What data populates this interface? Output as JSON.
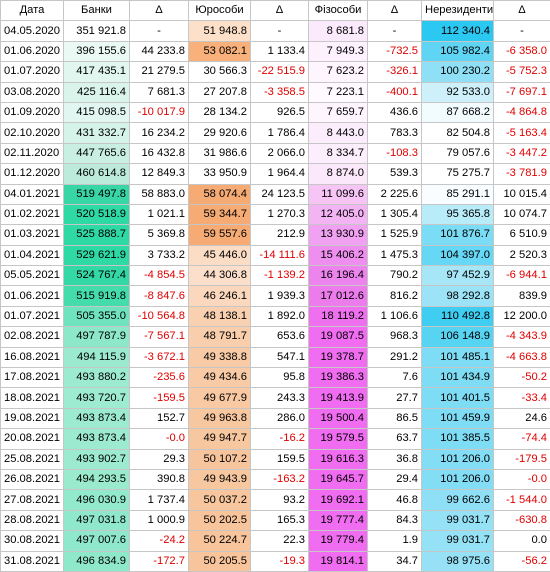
{
  "headers": [
    "Дата",
    "Банки",
    "Δ",
    "Юрособи",
    "Δ",
    "Фізособи",
    "Δ",
    "Нерезиденти",
    "Δ"
  ],
  "colors": {
    "negative": "#e00000",
    "banks_scale": [
      "#ffffff",
      "#e3f6ef",
      "#2fd9a4"
    ],
    "yur_scale": [
      "#fde8d8",
      "#f6ab75"
    ],
    "fiz_scale": [
      "#fbe7fb",
      "#f06cf0"
    ],
    "nonres_scale": [
      "#eaf7fc",
      "#12c8f1"
    ]
  },
  "rows": [
    {
      "date": "04.05.2020",
      "banks": "351 921.8",
      "d1": "-",
      "yur": "51 948.8",
      "d2": "-",
      "fiz": "8 681.8",
      "d3": "-",
      "nonres": "112 340.4",
      "d4": "-",
      "bg": [
        "#ffffff",
        "#fde0c9",
        "#fbeafb",
        "#2bc9f1"
      ]
    },
    {
      "date": "01.06.2020",
      "banks": "396 155.6",
      "d1": "44 233.8",
      "yur": "53 082.1",
      "d2": "1 133.4",
      "fiz": "7 949.3",
      "d3": "-732.5",
      "nonres": "105 982.4",
      "d4": "-6 358.0",
      "bg": [
        "#ebf9f5",
        "#f8b17b",
        "#fdf1fd",
        "#5fd4f3"
      ]
    },
    {
      "date": "01.07.2020",
      "banks": "417 435.1",
      "d1": "21 279.5",
      "yur": "30 566.3",
      "d2": "-22 515.9",
      "fiz": "7 623.2",
      "d3": "-326.1",
      "nonres": "100 230.2",
      "d4": "-5 752.3",
      "bg": [
        "#e0f6ef",
        "#ffffff",
        "#fef5fe",
        "#8fe0f6"
      ]
    },
    {
      "date": "03.08.2020",
      "banks": "425 116.4",
      "d1": "7 681.3",
      "yur": "27 207.8",
      "d2": "-3 358.5",
      "fiz": "7 223.1",
      "d3": "-400.1",
      "nonres": "92 533.0",
      "d4": "-7 697.1",
      "bg": [
        "#daf4ec",
        "#ffffff",
        "#fffaff",
        "#cdf0fa"
      ]
    },
    {
      "date": "01.09.2020",
      "banks": "415 098.5",
      "d1": "-10 017.9",
      "yur": "28 134.2",
      "d2": "926.5",
      "fiz": "7 659.7",
      "d3": "436.6",
      "nonres": "87 668.2",
      "d4": "-4 864.8",
      "bg": [
        "#e1f6f0",
        "#ffffff",
        "#fef5fe",
        "#f2fbfe"
      ]
    },
    {
      "date": "02.10.2020",
      "banks": "431 332.7",
      "d1": "16 234.2",
      "yur": "29 920.6",
      "d2": "1 786.4",
      "fiz": "8 443.0",
      "d3": "783.3",
      "nonres": "82 504.8",
      "d4": "-5 163.4",
      "bg": [
        "#d6f3ea",
        "#ffffff",
        "#fcedfc",
        "#ffffff"
      ]
    },
    {
      "date": "02.11.2020",
      "banks": "447 765.6",
      "d1": "16 432.8",
      "yur": "31 986.6",
      "d2": "2 066.0",
      "fiz": "8 334.7",
      "d3": "-108.3",
      "nonres": "79 057.6",
      "d4": "-3 447.2",
      "bg": [
        "#c9efe3",
        "#ffffff",
        "#fceefc",
        "#ffffff"
      ]
    },
    {
      "date": "01.12.2020",
      "banks": "460 614.8",
      "d1": "12 849.3",
      "yur": "33 950.9",
      "d2": "1 964.4",
      "fiz": "8 874.0",
      "d3": "539.3",
      "nonres": "75 275.7",
      "d4": "-3 781.9",
      "bg": [
        "#bcebdc",
        "#ffffff",
        "#fbe8fb",
        "#ffffff"
      ]
    },
    {
      "date": "04.01.2021",
      "banks": "519 497.8",
      "d1": "58 883.0",
      "yur": "58 074.4",
      "d2": "24 123.5",
      "fiz": "11 099.6",
      "d3": "2 225.6",
      "nonres": "85 291.1",
      "d4": "10 015.4",
      "bg": [
        "#38d6a5",
        "#f6ab75",
        "#f6c5f6",
        "#fafdff"
      ]
    },
    {
      "date": "01.02.2021",
      "banks": "520 518.9",
      "d1": "1 021.1",
      "yur": "59 344.7",
      "d2": "1 270.3",
      "fiz": "12 405.0",
      "d3": "1 305.4",
      "nonres": "95 365.8",
      "d4": "10 074.7",
      "bg": [
        "#2fd9a4",
        "#f6ab75",
        "#f3b4f3",
        "#b8ecf9"
      ]
    },
    {
      "date": "01.03.2021",
      "banks": "525 888.7",
      "d1": "5 369.8",
      "yur": "59 557.6",
      "d2": "212.9",
      "fiz": "13 930.9",
      "d3": "1 525.9",
      "nonres": "101 876.7",
      "d4": "6 510.9",
      "bg": [
        "#2fd9a4",
        "#f6ab75",
        "#f1a1f1",
        "#7bdcf5"
      ]
    },
    {
      "date": "01.04.2021",
      "banks": "529 621.9",
      "d1": "3 733.2",
      "yur": "45 446.0",
      "d2": "-14 111.6",
      "fiz": "15 406.2",
      "d3": "1 475.3",
      "nonres": "104 397.0",
      "d4": "2 520.3",
      "bg": [
        "#2fd9a4",
        "#fbdcc4",
        "#ee8eee",
        "#66d7f4"
      ]
    },
    {
      "date": "05.05.2021",
      "banks": "524 767.4",
      "d1": "-4 854.5",
      "yur": "44 306.8",
      "d2": "-1 139.2",
      "fiz": "16 196.4",
      "d3": "790.2",
      "nonres": "97 452.9",
      "d4": "-6 944.1",
      "bg": [
        "#33d8a5",
        "#fcdfca",
        "#ed84ed",
        "#a6e6f7"
      ]
    },
    {
      "date": "01.06.2021",
      "banks": "515 919.8",
      "d1": "-8 847.6",
      "yur": "46 246.1",
      "d2": "1 939.3",
      "fiz": "17 012.6",
      "d3": "816.2",
      "nonres": "98 292.8",
      "d4": "839.9",
      "bg": [
        "#45dcac",
        "#fbd8bd",
        "#ec7cec",
        "#9de3f7"
      ]
    },
    {
      "date": "01.07.2021",
      "banks": "505 355.0",
      "d1": "-10 564.8",
      "yur": "48 138.1",
      "d2": "1 892.0",
      "fiz": "18 119.2",
      "d3": "1 106.6",
      "nonres": "110 492.8",
      "d4": "12 200.0",
      "bg": [
        "#6fe3bd",
        "#f9d1b1",
        "#ef70ef",
        "#3fcef2"
      ]
    },
    {
      "date": "02.08.2021",
      "banks": "497 787.9",
      "d1": "-7 567.1",
      "yur": "48 791.7",
      "d2": "653.6",
      "fiz": "19 087.5",
      "d3": "968.3",
      "nonres": "106 148.9",
      "d4": "-4 343.9",
      "bg": [
        "#8de8ca",
        "#f9ceac",
        "#f06cf0",
        "#58d4f3"
      ]
    },
    {
      "date": "16.08.2021",
      "banks": "494 115.9",
      "d1": "-3 672.1",
      "yur": "49 338.8",
      "d2": "547.1",
      "fiz": "19 378.7",
      "d3": "291.2",
      "nonres": "101 485.1",
      "d4": "-4 663.8",
      "bg": [
        "#9beacf",
        "#f8cba6",
        "#f06cf0",
        "#7edcf5"
      ]
    },
    {
      "date": "17.08.2021",
      "banks": "493 880.2",
      "d1": "-235.6",
      "yur": "49 434.6",
      "d2": "95.8",
      "fiz": "19 386.3",
      "d3": "7.6",
      "nonres": "101 434.9",
      "d4": "-50.2",
      "bg": [
        "#9ceacf",
        "#f8caa5",
        "#f06cf0",
        "#7fdcf5"
      ]
    },
    {
      "date": "18.08.2021",
      "banks": "493 720.7",
      "d1": "-159.5",
      "yur": "49 677.9",
      "d2": "243.3",
      "fiz": "19 413.9",
      "d3": "27.7",
      "nonres": "101 401.5",
      "d4": "-33.4",
      "bg": [
        "#9debd0",
        "#f8c9a3",
        "#f06cf0",
        "#7fdcf5"
      ]
    },
    {
      "date": "19.08.2021",
      "banks": "493 873.4",
      "d1": "152.7",
      "yur": "49 963.8",
      "d2": "286.0",
      "fiz": "19 500.4",
      "d3": "86.5",
      "nonres": "101 459.9",
      "d4": "24.6",
      "bg": [
        "#9ceacf",
        "#f7c7a0",
        "#f06cf0",
        "#7fdcf5"
      ]
    },
    {
      "date": "20.08.2021",
      "banks": "493 873.4",
      "d1": "-0.0",
      "yur": "49 947.7",
      "d2": "-16.2",
      "fiz": "19 579.5",
      "d3": "63.7",
      "nonres": "101 385.5",
      "d4": "-74.4",
      "bg": [
        "#9ceacf",
        "#f7c7a0",
        "#f06cf0",
        "#7fdcf5"
      ]
    },
    {
      "date": "25.08.2021",
      "banks": "493 902.7",
      "d1": "29.3",
      "yur": "50 107.2",
      "d2": "159.5",
      "fiz": "19 616.3",
      "d3": "36.8",
      "nonres": "101 206.0",
      "d4": "-179.5",
      "bg": [
        "#9ceacf",
        "#f7c59d",
        "#f06cf0",
        "#82ddf5"
      ]
    },
    {
      "date": "26.08.2021",
      "banks": "494 293.5",
      "d1": "390.8",
      "yur": "49 943.9",
      "d2": "-163.2",
      "fiz": "19 645.7",
      "d3": "29.4",
      "nonres": "101 206.0",
      "d4": "-0.0",
      "bg": [
        "#9aeace",
        "#f7c7a0",
        "#f06cf0",
        "#82ddf5"
      ]
    },
    {
      "date": "27.08.2021",
      "banks": "496 030.9",
      "d1": "1 737.4",
      "yur": "50 037.2",
      "d2": "93.2",
      "fiz": "19 692.1",
      "d3": "46.8",
      "nonres": "99 662.6",
      "d4": "-1 544.0",
      "bg": [
        "#93e9cc",
        "#f7c69e",
        "#f06cf0",
        "#8fe0f6"
      ]
    },
    {
      "date": "28.08.2021",
      "banks": "497 031.8",
      "d1": "1 000.9",
      "yur": "50 202.5",
      "d2": "165.3",
      "fiz": "19 777.4",
      "d3": "84.3",
      "nonres": "99 031.7",
      "d4": "-630.8",
      "bg": [
        "#8fe8cb",
        "#f7c49b",
        "#f06cf0",
        "#95e1f6"
      ]
    },
    {
      "date": "30.08.2021",
      "banks": "497 007.6",
      "d1": "-24.2",
      "yur": "50 224.7",
      "d2": "22.3",
      "fiz": "19 779.4",
      "d3": "1.9",
      "nonres": "99 031.7",
      "d4": "0.0",
      "bg": [
        "#8fe8cb",
        "#f7c49b",
        "#f06cf0",
        "#95e1f6"
      ]
    },
    {
      "date": "31.08.2021",
      "banks": "496 834.9",
      "d1": "-172.7",
      "yur": "50 205.5",
      "d2": "-19.3",
      "fiz": "19 814.1",
      "d3": "34.7",
      "nonres": "98 975.6",
      "d4": "-56.2",
      "bg": [
        "#90e8cb",
        "#f7c49b",
        "#f06cf0",
        "#96e1f6"
      ]
    }
  ]
}
